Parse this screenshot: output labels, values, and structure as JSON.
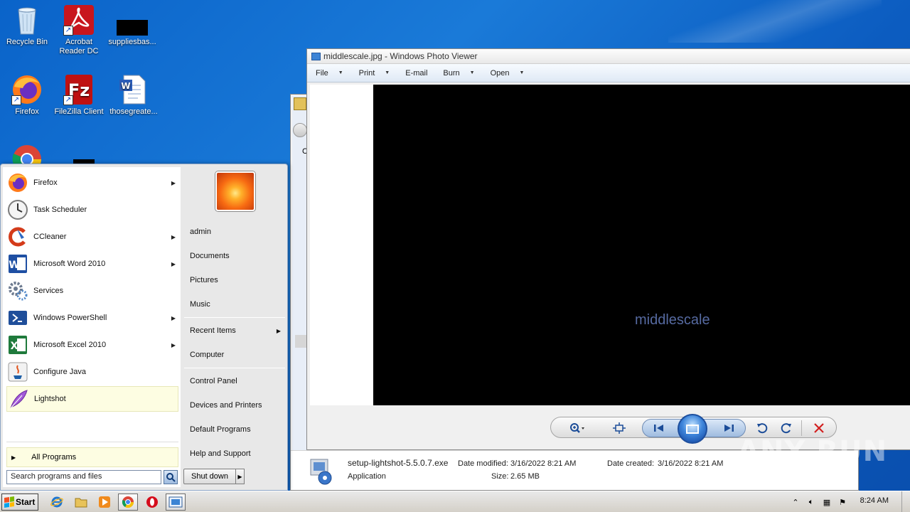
{
  "desktop": {
    "icons": [
      {
        "label": "Recycle Bin",
        "icon": "recycle-bin-icon"
      },
      {
        "label": "Acrobat\nReader DC",
        "icon": "acrobat-icon"
      },
      {
        "label": "suppliesbas...",
        "icon": "file-icon"
      },
      {
        "label": "Firefox",
        "icon": "firefox-icon"
      },
      {
        "label": "FileZilla Client",
        "icon": "filezilla-icon"
      },
      {
        "label": "thosegreate...",
        "icon": "word-doc-icon"
      }
    ]
  },
  "photo_viewer": {
    "title": "middlescale.jpg - Windows Photo Viewer",
    "menu": {
      "file": "File",
      "print": "Print",
      "email": "E-mail",
      "burn": "Burn",
      "open": "Open"
    },
    "image_text": "middlescale"
  },
  "explorer": {
    "file_name": "setup-lightshot-5.5.0.7.exe",
    "file_type": "Application",
    "date_modified_label": "Date modified:",
    "date_modified": "3/16/2022 8:21 AM",
    "date_created_label": "Date created:",
    "date_created": "3/16/2022 8:21 AM",
    "size_label": "Size:",
    "size": "2.65 MB",
    "side_letter": "C"
  },
  "start_menu": {
    "programs": [
      {
        "label": "Firefox",
        "has_arrow": true
      },
      {
        "label": "Task Scheduler",
        "has_arrow": false
      },
      {
        "label": "CCleaner",
        "has_arrow": true
      },
      {
        "label": "Microsoft Word 2010",
        "has_arrow": true
      },
      {
        "label": "Services",
        "has_arrow": false
      },
      {
        "label": "Windows PowerShell",
        "has_arrow": true
      },
      {
        "label": "Microsoft Excel 2010",
        "has_arrow": true
      },
      {
        "label": "Configure Java",
        "has_arrow": false
      },
      {
        "label": "Lightshot",
        "has_arrow": false
      }
    ],
    "all_programs": "All Programs",
    "search_placeholder": "Search programs and files",
    "right_links": {
      "user": "admin",
      "documents": "Documents",
      "pictures": "Pictures",
      "music": "Music",
      "recent_items": "Recent Items",
      "computer": "Computer",
      "control_panel": "Control Panel",
      "devices_printers": "Devices and Printers",
      "default_programs": "Default Programs",
      "help_support": "Help and Support"
    },
    "shutdown": "Shut down"
  },
  "taskbar": {
    "start": "Start",
    "clock": "8:24 AM"
  },
  "watermark": "ANY RUN",
  "colors": {
    "desktop_blue": "#0a63c9",
    "highlight_yellow": "#fdfde2",
    "image_text": "#566aa1"
  }
}
